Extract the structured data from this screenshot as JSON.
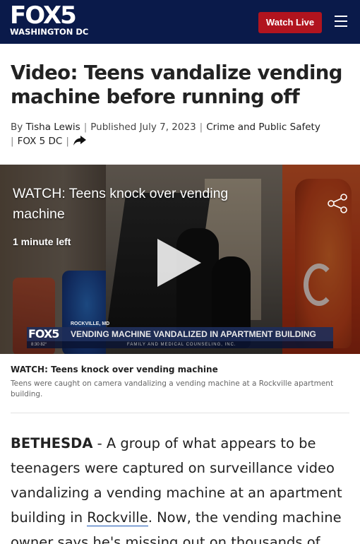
{
  "header": {
    "logo_main": "FOX5",
    "logo_sub": "WASHINGTON DC",
    "watch_live_label": "Watch Live"
  },
  "article": {
    "headline": "Video: Teens vandalize vending machine before running off",
    "byline": {
      "by_prefix": "By",
      "author": "Tisha Lewis",
      "published": "Published July 7, 2023",
      "category": "Crime and Public Safety",
      "source": "FOX 5 DC"
    },
    "video": {
      "title": "WATCH: Teens knock over vending machine",
      "time_left": "1 minute left",
      "chyron_logo": "FOX5",
      "chyron_location": "ROCKVILLE, MD",
      "chyron_headline": "VENDING MACHINE VANDALIZED IN APARTMENT BUILDING",
      "chyron_sub": "FAMILY AND MEDICAL COUNSELING, INC.",
      "chyron_clock": "8:30  82°"
    },
    "caption": {
      "title": "WATCH: Teens knock over vending machine",
      "description": "Teens were caught on camera vandalizing a vending machine at a Rockville apartment building."
    },
    "body": {
      "dateline": "BETHESDA",
      "text_before_link": " - A group of what appears to be teenagers were captured on surveillance video vandalizing a vending machine at an apartment building in ",
      "link_text": "Rockville",
      "text_after_link": ". Now, the vending machine owner says he's missing out on thousands of"
    }
  },
  "colors": {
    "header_bg": "#0a1a4a",
    "watch_live_bg": "#b1141e",
    "link_underline": "#1a55b4"
  }
}
